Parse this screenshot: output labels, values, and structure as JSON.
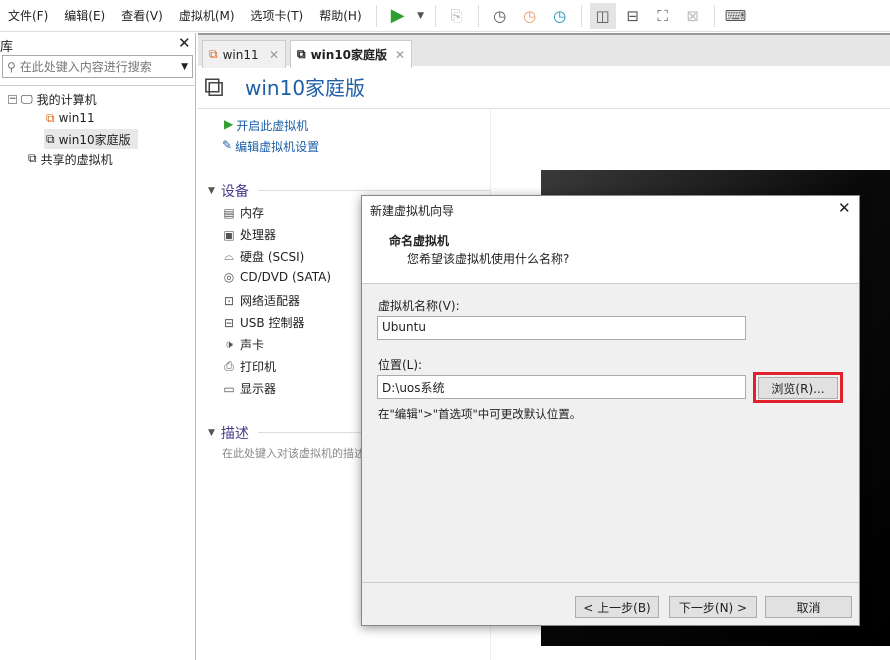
{
  "menu": [
    "文件(F)",
    "编辑(E)",
    "查看(V)",
    "虚拟机(M)",
    "选项卡(T)",
    "帮助(H)"
  ],
  "library": {
    "title": "库",
    "search_placeholder": "在此处键入内容进行搜索",
    "tree": {
      "root": "我的计算机",
      "vms": [
        "win11",
        "win10家庭版"
      ],
      "shared": "共享的虚拟机"
    }
  },
  "tabs": [
    {
      "label": "win11"
    },
    {
      "label": "win10家庭版"
    }
  ],
  "vm": {
    "title": "win10家庭版",
    "actions": [
      "开启此虚拟机",
      "编辑虚拟机设置"
    ],
    "devices_heading": "设备",
    "devices": [
      "内存",
      "处理器",
      "硬盘 (SCSI)",
      "CD/DVD (SATA)",
      "网络适配器",
      "USB 控制器",
      "声卡",
      "打印机",
      "显示器"
    ],
    "desc_heading": "描述",
    "desc_placeholder": "在此处键入对该虚拟机的描述"
  },
  "dialog": {
    "title": "新建虚拟机向导",
    "heading": "命名虚拟机",
    "subheading": "您希望该虚拟机使用什么名称?",
    "name_label": "虚拟机名称(V):",
    "name_value": "Ubuntu",
    "location_label": "位置(L):",
    "location_value": "D:\\uos系统",
    "browse": "浏览(R)...",
    "hint": "在\"编辑\">\"首选项\"中可更改默认位置。",
    "back": "< 上一步(B)",
    "next": "下一步(N) >",
    "cancel": "取消"
  },
  "colors": {
    "accent": "#1e5fa8",
    "play": "#2e9e2e",
    "highlight": "#e0202a"
  }
}
